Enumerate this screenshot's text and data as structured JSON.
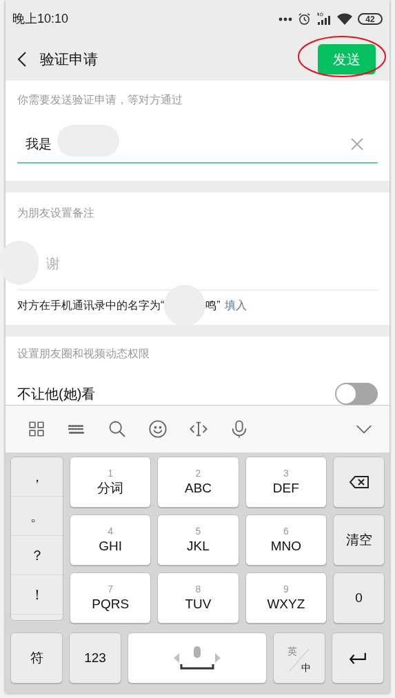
{
  "status_bar": {
    "time": "晚上10:10",
    "battery": "42"
  },
  "header": {
    "title": "验证申请",
    "send_button": "发送"
  },
  "verification": {
    "hint": "你需要发送验证申请，等对方通过",
    "value": "我是"
  },
  "remark": {
    "label": "为朋友设置备注",
    "value": "谢",
    "note_prefix": "对方在手机通讯录中的名字为“",
    "note_suffix": "鸣”",
    "fill_link": "填入"
  },
  "moments": {
    "label": "设置朋友圈和视频动态权限",
    "rows": [
      {
        "label": "不让他(她)看",
        "on": false
      }
    ]
  },
  "keyboard": {
    "punctuation": [
      "，",
      "。",
      "？",
      "！"
    ],
    "keys": [
      {
        "digit": "1",
        "letters": "分词"
      },
      {
        "digit": "2",
        "letters": "ABC"
      },
      {
        "digit": "3",
        "letters": "DEF"
      },
      {
        "digit": "4",
        "letters": "GHI"
      },
      {
        "digit": "5",
        "letters": "JKL"
      },
      {
        "digit": "6",
        "letters": "MNO"
      },
      {
        "digit": "7",
        "letters": "PQRS"
      },
      {
        "digit": "8",
        "letters": "TUV"
      },
      {
        "digit": "9",
        "letters": "WXYZ"
      }
    ],
    "side_keys": [
      {
        "kind": "backspace"
      },
      {
        "kind": "text",
        "label": "清空"
      },
      {
        "kind": "text",
        "label": "0"
      }
    ],
    "bottom_keys": [
      {
        "kind": "text",
        "label": "符"
      },
      {
        "kind": "text",
        "label": "123"
      },
      {
        "kind": "space"
      },
      {
        "kind": "lang",
        "upper": "英",
        "lower": "中"
      },
      {
        "kind": "enter"
      }
    ]
  }
}
